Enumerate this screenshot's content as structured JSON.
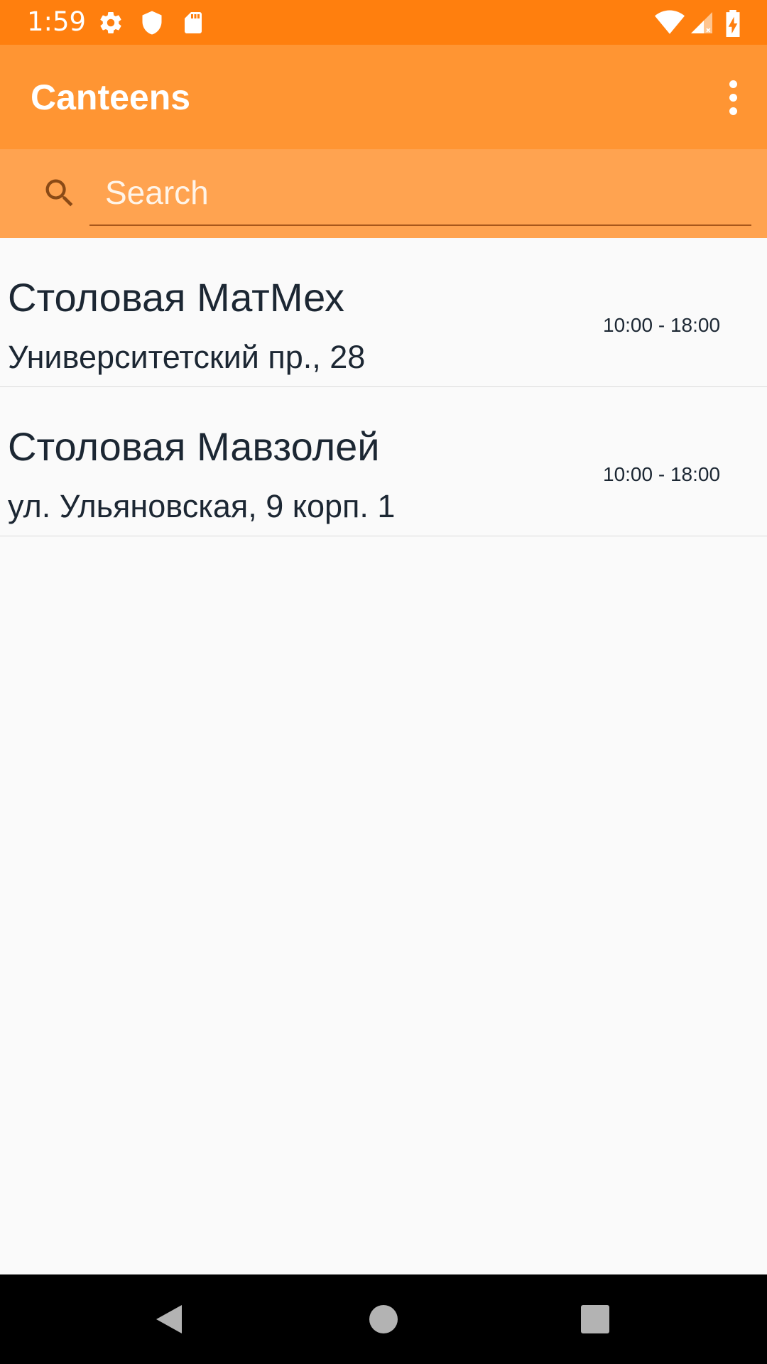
{
  "status_bar": {
    "time": "1:59",
    "left_icons": [
      "gear-icon",
      "shield-icon",
      "sd-card-icon"
    ],
    "right_icons": [
      "wifi-icon",
      "signal-icon",
      "battery-charging-icon"
    ]
  },
  "app_bar": {
    "title": "Canteens",
    "menu_icon": "more-vert-icon"
  },
  "search": {
    "placeholder": "Search",
    "value": ""
  },
  "canteens": [
    {
      "name": "Столовая МатМех",
      "address": "Университетский пр., 28",
      "hours": "10:00 - 18:00"
    },
    {
      "name": "Столовая Мавзолей",
      "address": "ул. Ульяновская, 9 корп. 1",
      "hours": "10:00 - 18:00"
    }
  ],
  "nav_bar": {
    "buttons": [
      "back-icon",
      "home-icon",
      "recents-icon"
    ]
  },
  "colors": {
    "status_bar": "#ff7f0e",
    "app_bar": "#ff9533",
    "search_bar": "#ffa350",
    "text_dark": "#1c2733"
  }
}
